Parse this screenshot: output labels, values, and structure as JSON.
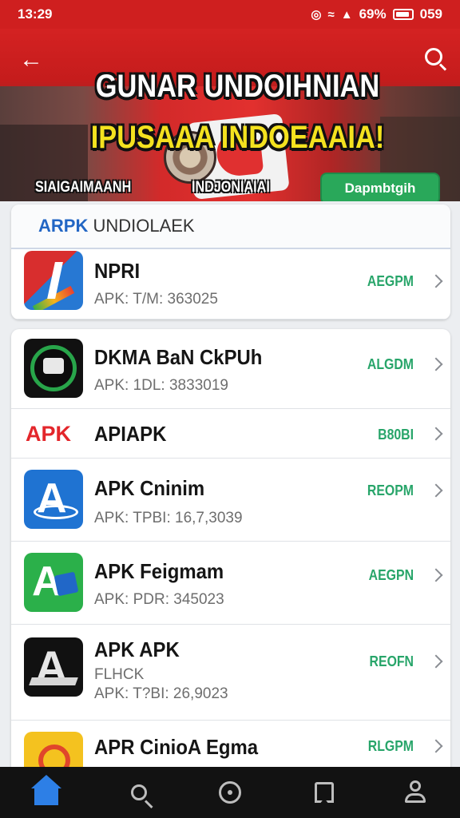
{
  "status_bar": {
    "time": "13:29",
    "battery": "69%",
    "right_time": "059",
    "icons": [
      "nfc-icon",
      "wifi-icon",
      "signal-icon",
      "battery-icon"
    ]
  },
  "header": {
    "title": "GUNAR UNDOIHNIAN",
    "subtitle": "IPUSAAA INDOEAAIA!",
    "tag_left": "SIAIGAIMAANH",
    "tag_right": "INDJONIAIAI",
    "cta_label": "Dapmbtgih",
    "accent_color": "#cf1f1f"
  },
  "section": {
    "header_blue": "ARPK",
    "header_rest": " UNDIOLAEK"
  },
  "featured": {
    "name": "NPRI",
    "meta": "APK: T/M: 363025",
    "action": "AEGPM"
  },
  "apps": [
    {
      "name": "DKMA BaN CkPUh",
      "meta": "APK: 1DL: 3833019",
      "action": "ALGDM"
    },
    {
      "name": "APIAPK",
      "icon_text": "APK",
      "action": "B80BI"
    },
    {
      "name": "APK Cninim",
      "meta": "APK: TPBI: 16,7,3039",
      "action": "REOPM"
    },
    {
      "name": "APK Feigmam",
      "meta": "APK: PDR: 345023",
      "action": "AEGPN"
    },
    {
      "name": "APK APK",
      "meta": "FLHCK",
      "meta2": "APK: T?BI: 26,9023",
      "action": "REOFN"
    },
    {
      "name": "APR CinioA Egma",
      "action": "RLGPM"
    }
  ],
  "bottom_nav": [
    "home-icon",
    "search-icon",
    "discover-icon",
    "library-icon",
    "profile-icon"
  ],
  "colors": {
    "action_green": "#28a56a",
    "nav_active": "#2d7fe6",
    "cta_green": "#29a85a"
  }
}
